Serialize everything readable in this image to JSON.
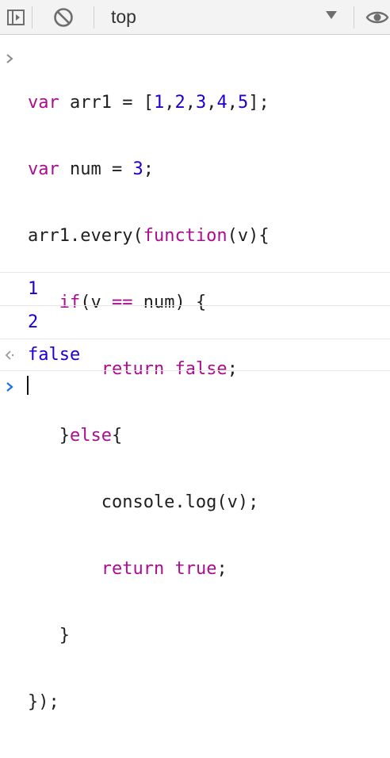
{
  "toolbar": {
    "context_label": "top",
    "sidebar_icon": "sidebar-toggle-icon",
    "clear_icon": "clear-console-icon",
    "eye_icon": "eye-icon",
    "dropdown_icon": "triangle-down-icon"
  },
  "console": {
    "code_lines": [
      "var arr1 = [1,2,3,4,5];",
      "var num = 3;",
      "arr1.every(function(v){",
      "   if(v == num) {",
      "       return false;",
      "   }else{",
      "       console.log(v);",
      "       return true;",
      "   }",
      "});"
    ],
    "logs": [
      "1",
      "2"
    ],
    "result": "false"
  },
  "colors": {
    "keyword": "#aa0d91",
    "number": "#1c00cf",
    "prompt": "#1a73e8",
    "output": "#1c00cf"
  }
}
